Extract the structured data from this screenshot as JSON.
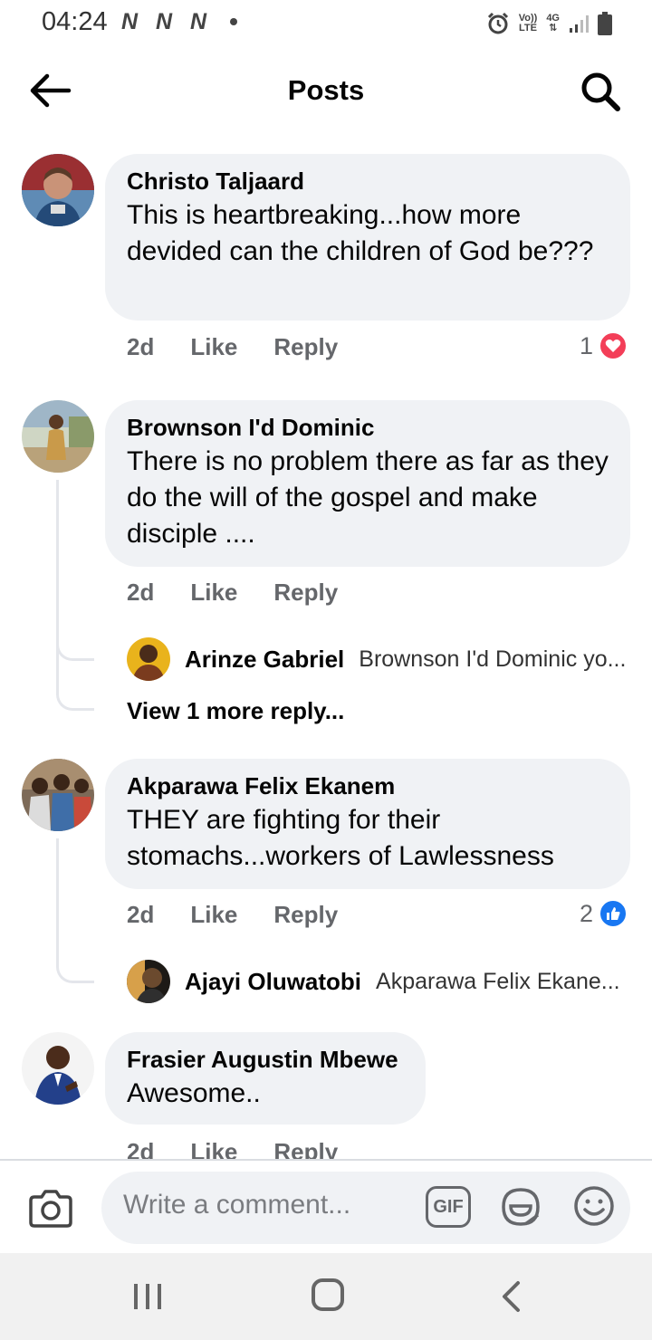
{
  "status_bar": {
    "time": "04:24",
    "network_glyph": "N",
    "volte_top": "Vo))",
    "volte_bottom": "LTE",
    "network_type": "4G"
  },
  "header": {
    "title": "Posts"
  },
  "comments": [
    {
      "author": "Christo Taljaard",
      "text": "This is heartbreaking...how more devided can the children of God be???",
      "time": "2d",
      "like": "Like",
      "reply": "Reply",
      "reaction_count": "1",
      "reaction_type": "love-icon"
    },
    {
      "author": "Brownson I'd Dominic",
      "text": "There is no problem there as far as they do the will of the gospel and make disciple ....",
      "time": "2d",
      "like": "Like",
      "reply": "Reply",
      "replies": [
        {
          "author": "Arinze Gabriel",
          "text": "Brownson I'd Dominic yo..."
        }
      ],
      "view_more": "View 1 more reply..."
    },
    {
      "author": "Akparawa Felix Ekanem",
      "text": "THEY are fighting for their stomachs...workers of Lawlessness",
      "time": "2d",
      "like": "Like",
      "reply": "Reply",
      "reaction_count": "2",
      "reaction_type": "like-icon",
      "replies": [
        {
          "author": "Ajayi Oluwatobi",
          "text": "Akparawa Felix Ekane..."
        }
      ]
    },
    {
      "author": "Frasier Augustin Mbewe",
      "text": "Awesome..",
      "time": "2d",
      "like": "Like",
      "reply": "Reply"
    }
  ],
  "composer": {
    "placeholder": "Write a comment...",
    "gif_label": "GIF"
  },
  "colors": {
    "bubble_bg": "#f0f2f5",
    "meta_text": "#65676b",
    "love_red": "#f33e58",
    "like_blue": "#1877f2"
  }
}
